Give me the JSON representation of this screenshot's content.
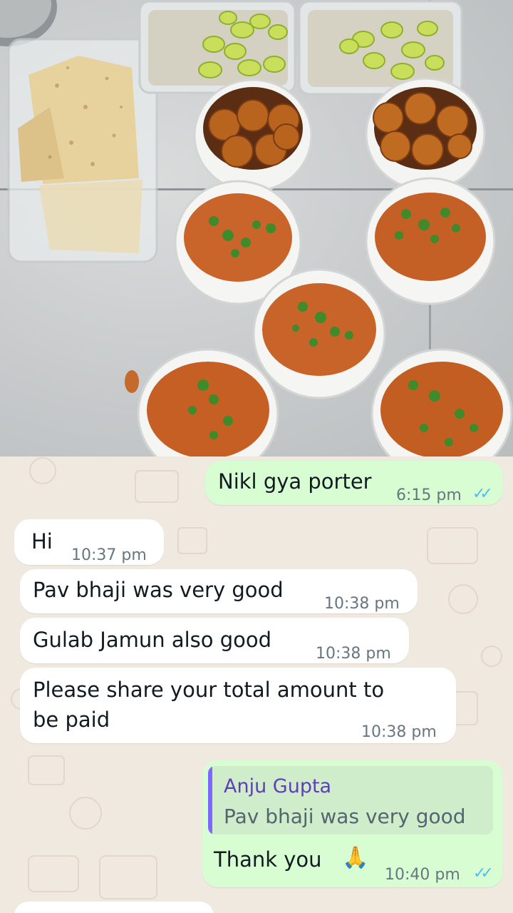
{
  "photo": {
    "description_icon": "food-photo"
  },
  "messages": [
    {
      "direction": "out",
      "text": "Nikl gya porter",
      "time": "6:15 pm",
      "status": "read-ticks"
    },
    {
      "direction": "in",
      "text": "Hi",
      "time": "10:37 pm"
    },
    {
      "direction": "in",
      "text": "Pav bhaji was very good",
      "time": "10:38 pm"
    },
    {
      "direction": "in",
      "text": "Gulab Jamun also good",
      "time": "10:38 pm"
    },
    {
      "direction": "in",
      "text_line1": "Please share your total amount to",
      "text_line2": "be paid",
      "time": "10:38 pm"
    },
    {
      "direction": "out",
      "quote_author": "Anju Gupta",
      "quote_text": "Pav bhaji was very good",
      "text": "Thank you",
      "emoji": "🙏",
      "time": "10:40 pm",
      "status": "read-ticks"
    }
  ],
  "colors": {
    "incoming_bubble": "#ffffff",
    "outgoing_bubble": "#d9fdd3",
    "read_ticks": "#53bdeb",
    "quote_bar": "#7f66ff"
  }
}
